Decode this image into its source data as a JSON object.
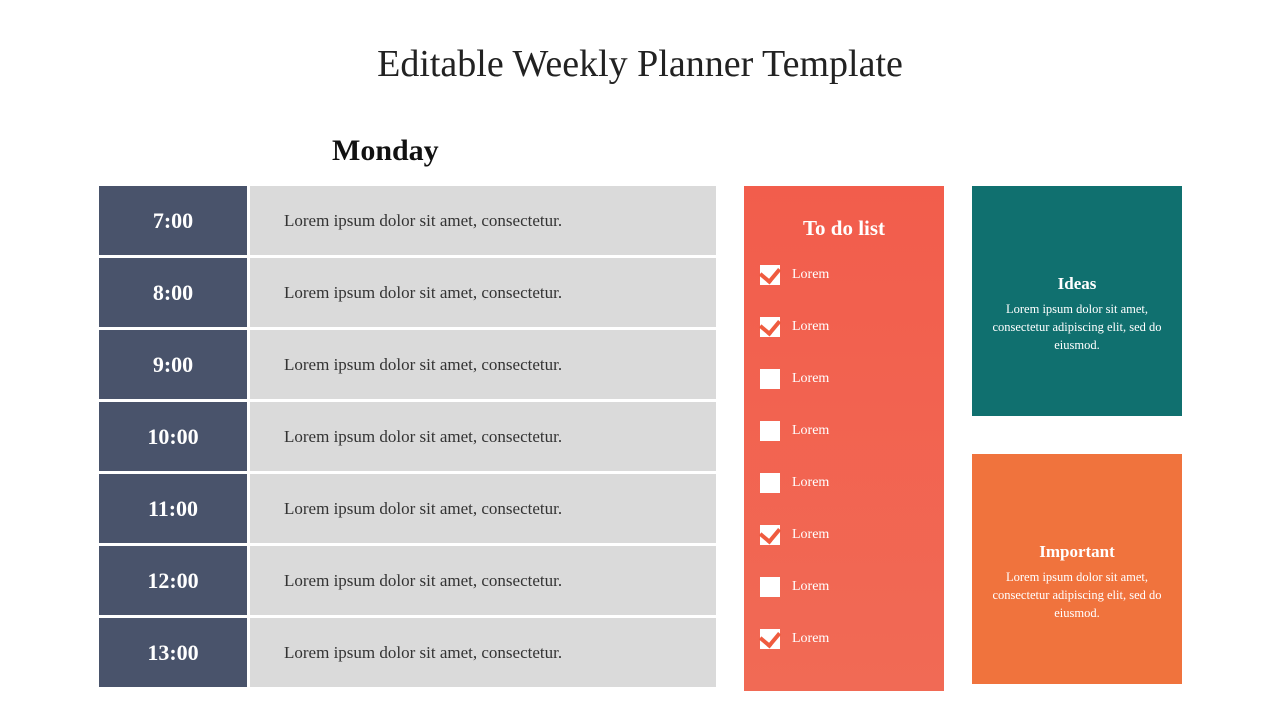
{
  "title": "Editable Weekly Planner Template",
  "day": "Monday",
  "schedule": [
    {
      "time": "7:00",
      "desc": "Lorem ipsum dolor sit amet, consectetur."
    },
    {
      "time": "8:00",
      "desc": "Lorem ipsum dolor sit amet, consectetur."
    },
    {
      "time": "9:00",
      "desc": "Lorem ipsum dolor sit amet, consectetur."
    },
    {
      "time": "10:00",
      "desc": "Lorem ipsum dolor sit amet, consectetur."
    },
    {
      "time": "11:00",
      "desc": "Lorem ipsum dolor sit amet, consectetur."
    },
    {
      "time": "12:00",
      "desc": "Lorem ipsum dolor sit amet, consectetur."
    },
    {
      "time": "13:00",
      "desc": "Lorem ipsum dolor sit amet, consectetur."
    }
  ],
  "todo": {
    "title": "To do list",
    "items": [
      {
        "label": "Lorem",
        "checked": true
      },
      {
        "label": "Lorem",
        "checked": true
      },
      {
        "label": "Lorem",
        "checked": false
      },
      {
        "label": "Lorem",
        "checked": false
      },
      {
        "label": "Lorem",
        "checked": false
      },
      {
        "label": "Lorem",
        "checked": true
      },
      {
        "label": "Lorem",
        "checked": false
      },
      {
        "label": "Lorem",
        "checked": true
      }
    ]
  },
  "ideas": {
    "title": "Ideas",
    "body": "Lorem ipsum dolor sit amet, consectetur adipiscing elit, sed do eiusmod."
  },
  "important": {
    "title": "Important",
    "body": "Lorem ipsum dolor sit amet, consectetur adipiscing elit, sed do eiusmod."
  }
}
